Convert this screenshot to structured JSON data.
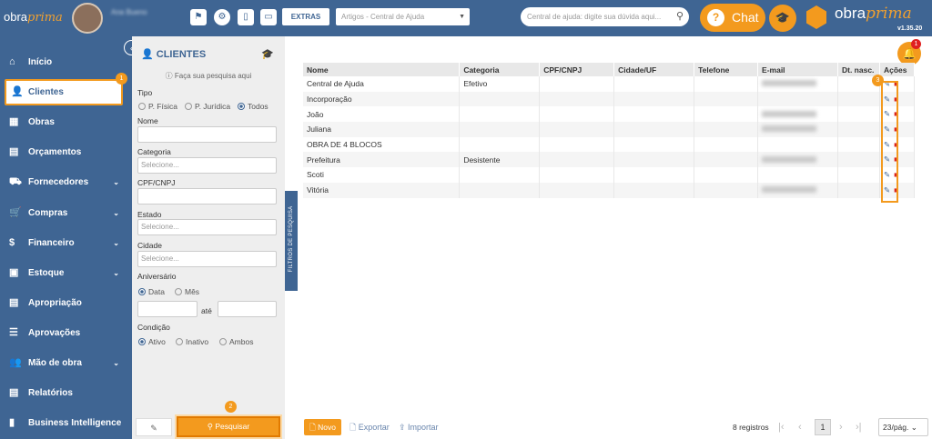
{
  "header": {
    "logo_text": "obra",
    "logo_italic": "prima",
    "user_name": "Ana Bueno",
    "extras": "EXTRAS",
    "module_select": "Artigos - Central de Ajuda",
    "search_placeholder": "Central de ajuda: digite sua dúvida aqui...",
    "chat": "Chat",
    "brand": "obra",
    "brand_italic": "prima",
    "version": "v1.35.20"
  },
  "sidebar": {
    "items": [
      {
        "label": "Início",
        "icon": "home-icon"
      },
      {
        "label": "Clientes",
        "icon": "user-icon",
        "active": true,
        "badge": "1"
      },
      {
        "label": "Obras",
        "icon": "building-icon"
      },
      {
        "label": "Orçamentos",
        "icon": "document-icon"
      },
      {
        "label": "Fornecedores",
        "icon": "truck-icon",
        "chev": true
      },
      {
        "label": "Compras",
        "icon": "cart-icon",
        "chev": true
      },
      {
        "label": "Financeiro",
        "icon": "dollar-icon",
        "chev": true
      },
      {
        "label": "Estoque",
        "icon": "box-icon",
        "chev": true
      },
      {
        "label": "Apropriação",
        "icon": "file-icon"
      },
      {
        "label": "Aprovações",
        "icon": "check-list-icon"
      },
      {
        "label": "Mão de obra",
        "icon": "workers-icon",
        "chev": true
      },
      {
        "label": "Relatórios",
        "icon": "report-icon"
      },
      {
        "label": "Business Intelligence",
        "icon": "chart-icon"
      }
    ]
  },
  "filters": {
    "title": "CLIENTES",
    "hint": "Faça sua pesquisa aqui",
    "tipo_label": "Tipo",
    "tipo_options": [
      "P. Física",
      "P. Jurídica",
      "Todos"
    ],
    "nome_label": "Nome",
    "categoria_label": "Categoria",
    "categoria_placeholder": "Selecione...",
    "cpf_label": "CPF/CNPJ",
    "estado_label": "Estado",
    "estado_placeholder": "Selecione...",
    "cidade_label": "Cidade",
    "cidade_placeholder": "Selecione...",
    "aniv_label": "Aniversário",
    "aniv_options": [
      "Data",
      "Mês"
    ],
    "ate": "até",
    "cond_label": "Condição",
    "cond_options": [
      "Ativo",
      "Inativo",
      "Ambos"
    ],
    "search_btn": "Pesquisar",
    "search_badge": "2",
    "tab_label": "FILTROS DE PESQUISA"
  },
  "table": {
    "headers": [
      "Nome",
      "Categoria",
      "CPF/CNPJ",
      "Cidade/UF",
      "Telefone",
      "E-mail",
      "Dt. nasc.",
      "Ações"
    ],
    "rows": [
      {
        "nome": "Central de Ajuda",
        "categoria": "Efetivo",
        "email": true
      },
      {
        "nome": "Incorporação",
        "categoria": "",
        "email": false
      },
      {
        "nome": "João",
        "categoria": "",
        "email": true
      },
      {
        "nome": "Juliana",
        "categoria": "",
        "email": true
      },
      {
        "nome": "OBRA DE 4 BLOCOS",
        "categoria": "",
        "email": false
      },
      {
        "nome": "Prefeitura",
        "categoria": "Desistente",
        "email": true
      },
      {
        "nome": "Scoti",
        "categoria": "",
        "email": false
      },
      {
        "nome": "Vitória",
        "categoria": "",
        "email": true
      }
    ],
    "actions_badge": "3"
  },
  "footer": {
    "novo": "Novo",
    "exportar": "Exportar",
    "importar": "Importar",
    "registros": "8 registros",
    "page": "1",
    "per_page": "23/pág."
  },
  "notifications": {
    "count": "1"
  },
  "colors": {
    "primary": "#3f6593",
    "accent": "#f39a1e"
  }
}
